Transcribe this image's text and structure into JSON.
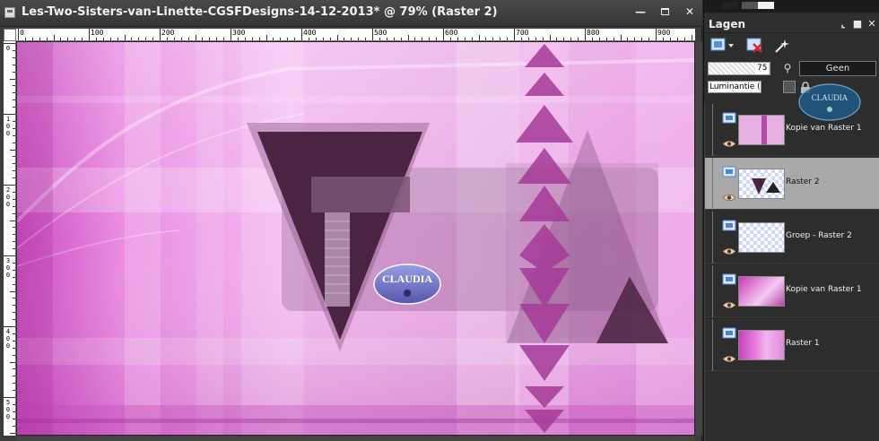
{
  "document": {
    "title": "Les-Two-Sisters-van-Linette-CGSFDesigns-14-12-2013* @  79% (Raster 2)",
    "ruler_labels_top": [
      "0",
      "100",
      "200",
      "300",
      "400",
      "500",
      "600",
      "700",
      "800",
      "900"
    ],
    "ruler_labels_left": [
      "0",
      "100",
      "200",
      "300",
      "400",
      "500"
    ],
    "watermark_text": "CLAUDIA"
  },
  "colors": {
    "canvas_base": "#e884e0",
    "canvas_light": "#f6c6f2",
    "triangle_dark": "#4a2441",
    "triangle_accent": "#a63a98",
    "selected_row": "#a9a9a9"
  },
  "layers_panel": {
    "title": "Lagen",
    "opacity_value": "75",
    "mask_label": "Geen",
    "blend_mode": "Luminantie (O)",
    "watermark_text": "CLAUDIA",
    "layers": [
      {
        "name": "Kopie van Raster 1",
        "selected": false,
        "icon": "raster-layer-icon"
      },
      {
        "name": "Raster 2",
        "selected": true,
        "icon": "raster-layer-icon"
      },
      {
        "name": "Groep - Raster 2",
        "selected": false,
        "icon": "group-layer-icon"
      },
      {
        "name": "Kopie van Raster 1",
        "selected": false,
        "icon": "raster-layer-icon"
      },
      {
        "name": "Raster 1",
        "selected": false,
        "icon": "raster-layer-icon"
      }
    ]
  }
}
